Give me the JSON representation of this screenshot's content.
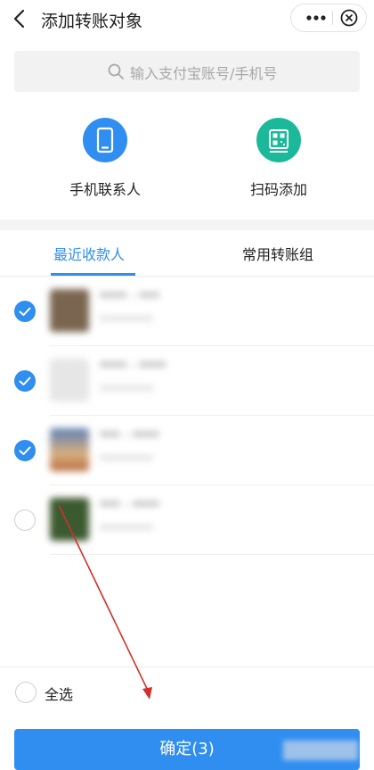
{
  "header": {
    "title": "添加转账对象",
    "back_icon": "chevron-left-icon",
    "more_icon": "more-dots-icon",
    "close_icon": "close-circle-icon"
  },
  "search": {
    "placeholder": "输入支付宝账号/手机号",
    "icon": "search-icon"
  },
  "shortcuts": [
    {
      "label": "手机联系人",
      "icon": "phone-icon",
      "color": "#2f8ef0"
    },
    {
      "label": "扫码添加",
      "icon": "qr-code-icon",
      "color": "#1bb99a"
    }
  ],
  "tabs": [
    {
      "label": "最近收款人",
      "active": true
    },
    {
      "label": "常用转账组",
      "active": false
    }
  ],
  "recipients": [
    {
      "selected": true,
      "name": "**** · ***",
      "sub": "**********"
    },
    {
      "selected": true,
      "name": "**** · ****",
      "sub": "**********"
    },
    {
      "selected": true,
      "name": "*** · ****",
      "sub": "**********"
    },
    {
      "selected": false,
      "name": "*** · ****",
      "sub": "**********"
    }
  ],
  "footer": {
    "select_all_label": "全选",
    "confirm_label": "确定(3)"
  },
  "colors": {
    "accent": "#2f8ef0",
    "scan_green": "#1bb99a",
    "annotation_red": "#d0302a"
  }
}
